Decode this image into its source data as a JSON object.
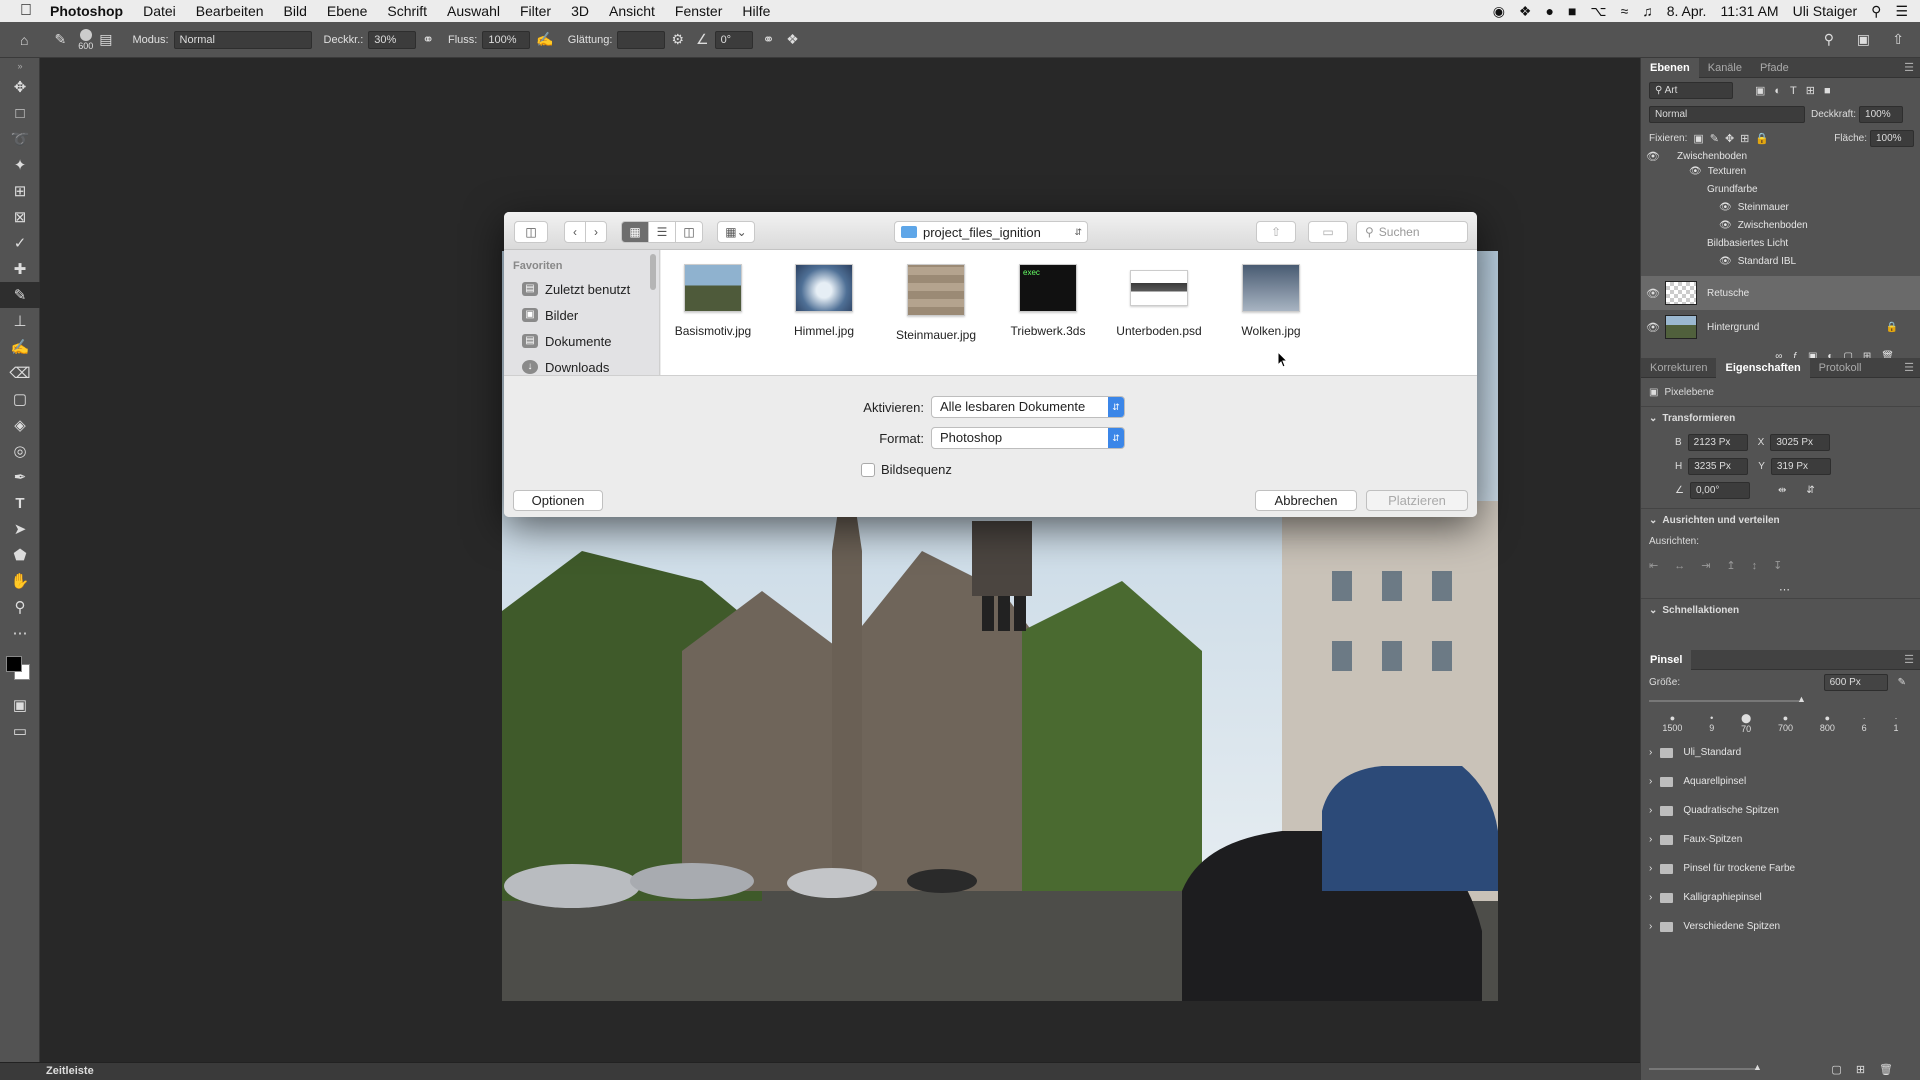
{
  "menubar": {
    "apple": "",
    "app": "Photoshop",
    "items": [
      "Datei",
      "Bearbeiten",
      "Bild",
      "Ebene",
      "Schrift",
      "Auswahl",
      "Filter",
      "3D",
      "Ansicht",
      "Fenster",
      "Hilfe"
    ],
    "date": "8. Apr.",
    "time": "11:31 AM",
    "user": "Uli Staiger"
  },
  "options": {
    "brush_size": "600",
    "modus_label": "Modus:",
    "modus_value": "Normal",
    "deckkr_label": "Deckkr.:",
    "deckkr_value": "30%",
    "fluss_label": "Fluss:",
    "fluss_value": "100%",
    "glaettung_label": "Glättung:",
    "glaettung_value": "",
    "angle_value": "0°"
  },
  "dialog": {
    "folder": "project_files_ignition",
    "search_placeholder": "Suchen",
    "sidebar_header": "Favoriten",
    "sidebar_items": [
      "Zuletzt benutzt",
      "Bilder",
      "Dokumente",
      "Downloads"
    ],
    "files": [
      "Basismotiv.jpg",
      "Himmel.jpg",
      "Steinmauer.jpg",
      "Triebwerk.3ds",
      "Unterboden.psd",
      "Wolken.jpg"
    ],
    "exec_label": "exec",
    "aktivieren_label": "Aktivieren:",
    "aktivieren_value": "Alle lesbaren Dokumente",
    "format_label": "Format:",
    "format_value": "Photoshop",
    "bildsequenz_label": "Bildsequenz",
    "optionen_label": "Optionen",
    "abbrechen_label": "Abbrechen",
    "platzieren_label": "Platzieren"
  },
  "layers": {
    "tabs": [
      "Ebenen",
      "Kanäle",
      "Pfade"
    ],
    "filter": "Art",
    "blend": "Normal",
    "deckkraft_label": "Deckkraft:",
    "deckkraft_value": "100%",
    "fixieren_label": "Fixieren:",
    "flaeche_label": "Fläche:",
    "flaeche_value": "100%",
    "group": "Zwischenboden",
    "texturen": "Texturen",
    "grundfarbe": "Grundfarbe",
    "steinmauer": "Steinmauer",
    "zwischenboden": "Zwischenboden",
    "licht": "Bildbasiertes Licht",
    "ibl": "Standard IBL",
    "retusche": "Retusche",
    "hintergrund": "Hintergrund"
  },
  "props": {
    "tabs": [
      "Korrekturen",
      "Eigenschaften",
      "Protokoll"
    ],
    "pixelebene": "Pixelebene",
    "transform": "Transformieren",
    "b_label": "B",
    "b_value": "2123 Px",
    "x_label": "X",
    "x_value": "3025 Px",
    "h_label": "H",
    "h_value": "3235 Px",
    "y_label": "Y",
    "y_value": "319 Px",
    "angle": "0,00°",
    "ausrichten": "Ausrichten und verteilen",
    "ausrichten_sub": "Ausrichten:",
    "schnell": "Schnellaktionen"
  },
  "brush": {
    "tab": "Pinsel",
    "groesse_label": "Größe:",
    "groesse_value": "600 Px",
    "tips": [
      "1500",
      "9",
      "70",
      "700",
      "800",
      "6",
      "1"
    ],
    "sets": [
      "Uli_Standard",
      "Aquarellpinsel",
      "Quadratische Spitzen",
      "Faux-Spitzen",
      "Pinsel für trockene Farbe",
      "Kalligraphiepinsel",
      "Verschiedene Spitzen"
    ]
  },
  "timeline": "Zeitleiste"
}
